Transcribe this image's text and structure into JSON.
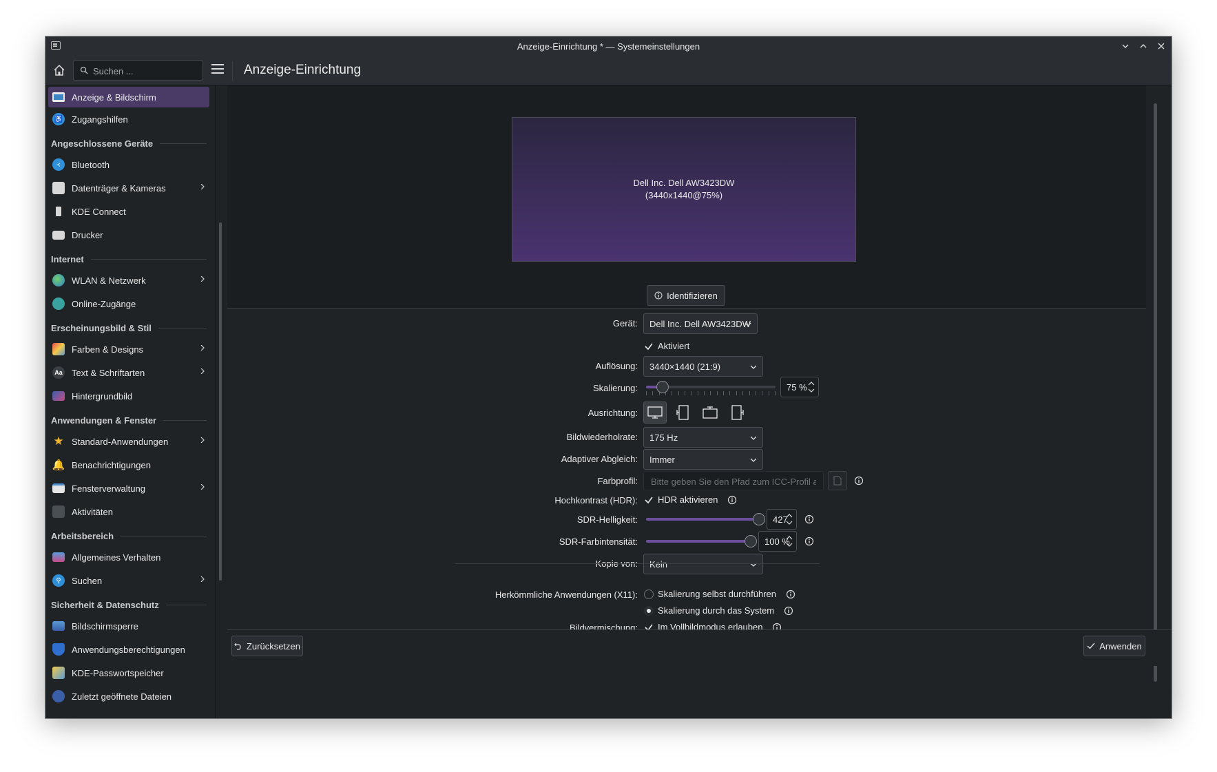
{
  "window": {
    "title": "Anzeige-Einrichtung * — Systemeinstellungen"
  },
  "header": {
    "search_placeholder": "Suchen ...",
    "page_title": "Anzeige-Einrichtung"
  },
  "sidebar": {
    "items": [
      {
        "label": "Anzeige & Bildschirm",
        "icon": "display-icon",
        "active": true
      },
      {
        "label": "Zugangshilfen",
        "icon": "accessibility-icon"
      }
    ],
    "categories": [
      {
        "title": "Angeschlossene Geräte",
        "items": [
          {
            "label": "Bluetooth",
            "icon": "bluetooth-icon"
          },
          {
            "label": "Datenträger & Kameras",
            "icon": "drive-icon",
            "chevron": true
          },
          {
            "label": "KDE Connect",
            "icon": "phone-icon"
          },
          {
            "label": "Drucker",
            "icon": "printer-icon"
          }
        ]
      },
      {
        "title": "Internet",
        "items": [
          {
            "label": "WLAN & Netzwerk",
            "icon": "globe-icon",
            "chevron": true
          },
          {
            "label": "Online-Zugänge",
            "icon": "online-accounts-icon"
          }
        ]
      },
      {
        "title": "Erscheinungsbild & Stil",
        "items": [
          {
            "label": "Farben & Designs",
            "icon": "palette-icon",
            "chevron": true
          },
          {
            "label": "Text & Schriftarten",
            "icon": "font-icon",
            "chevron": true
          },
          {
            "label": "Hintergrundbild",
            "icon": "wallpaper-icon"
          }
        ]
      },
      {
        "title": "Anwendungen & Fenster",
        "items": [
          {
            "label": "Standard-Anwendungen",
            "icon": "star-icon",
            "chevron": true
          },
          {
            "label": "Benachrichtigungen",
            "icon": "bell-icon"
          },
          {
            "label": "Fensterverwaltung",
            "icon": "window-icon",
            "chevron": true
          },
          {
            "label": "Aktivitäten",
            "icon": "activities-icon"
          }
        ]
      },
      {
        "title": "Arbeitsbereich",
        "items": [
          {
            "label": "Allgemeines Verhalten",
            "icon": "general-behavior-icon"
          },
          {
            "label": "Suchen",
            "icon": "search-icon",
            "chevron": true
          }
        ]
      },
      {
        "title": "Sicherheit & Datenschutz",
        "items": [
          {
            "label": "Bildschirmsperre",
            "icon": "screenlock-icon"
          },
          {
            "label": "Anwendungsberechtigungen",
            "icon": "shield-icon"
          },
          {
            "label": "KDE-Passwortspeicher",
            "icon": "wallet-icon"
          },
          {
            "label": "Zuletzt geöffnete Dateien",
            "icon": "clock-icon"
          }
        ]
      }
    ]
  },
  "preview": {
    "monitor_name": "Dell Inc. Dell AW3423DW",
    "monitor_mode": "(3440x1440@75%)",
    "identify_label": "Identifizieren"
  },
  "form": {
    "device_label": "Gerät:",
    "device_value": "Dell Inc. Dell AW3423DW",
    "enabled_label": "Aktiviert",
    "enabled_checked": true,
    "resolution_label": "Auflösung:",
    "resolution_value": "3440×1440 (21:9)",
    "scale_label": "Skalierung:",
    "scale_value": "75 %",
    "scale_slider_fraction": 0.13,
    "orientation_label": "Ausrichtung:",
    "refresh_label": "Bildwiederholrate:",
    "refresh_value": "175 Hz",
    "adaptive_label": "Adaptiver Abgleich:",
    "adaptive_value": "Immer",
    "color_profile_label": "Farbprofil:",
    "color_profile_placeholder": "Bitte geben Sie den Pfad zum ICC-Profil an ...",
    "hdr_label": "Hochkontrast (HDR):",
    "hdr_checkbox_label": "HDR aktivieren",
    "hdr_checked": true,
    "sdr_brightness_label": "SDR-Helligkeit:",
    "sdr_brightness_value": "427",
    "sdr_brightness_fraction": 1.0,
    "sdr_color_label": "SDR-Farbintensität:",
    "sdr_color_value": "100 %",
    "sdr_color_fraction": 1.0,
    "mirror_label": "Kopie von:",
    "mirror_value": "Kein",
    "legacy_label": "Herkömmliche Anwendungen (X11):",
    "legacy_option1": "Skalierung selbst durchführen",
    "legacy_option2": "Skalierung durch das System",
    "legacy_selected": 2,
    "tearing_label": "Bildvermischung:",
    "tearing_checkbox_label": "Im Vollbildmodus erlauben",
    "tearing_checked": true
  },
  "footer": {
    "reset_label": "Zurücksetzen",
    "apply_label": "Anwenden"
  },
  "colors": {
    "accent": "#6b4f9a",
    "active_item": "#4a3a66",
    "background": "#202326"
  }
}
